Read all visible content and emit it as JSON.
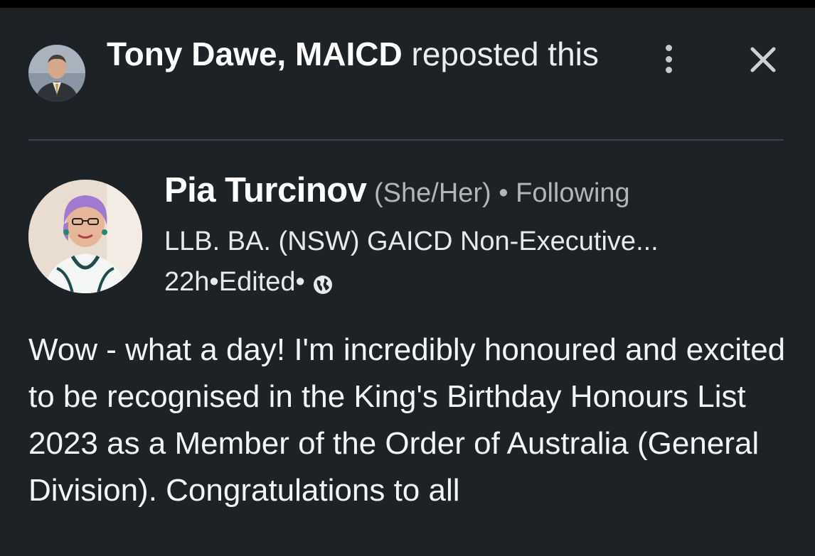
{
  "repost": {
    "name": "Tony Dawe, MAICD",
    "action": " reposted this"
  },
  "author": {
    "name": "Pia Turcinov",
    "pronouns": " (She/Her)",
    "separator1": " • ",
    "follow_status": "Following",
    "headline": "LLB. BA. (NSW) GAICD Non-Executive...",
    "time": "22h",
    "separator2": " • ",
    "edited": "Edited",
    "separator3": " • "
  },
  "post": {
    "text": "Wow - what a day! I'm incredibly honoured and excited to be recognised in the King's Birthday Honours List 2023 as a Member of the Order of Australia (General Division). Congratulations to all"
  },
  "icons": {
    "more": "more-vertical-icon",
    "close": "close-icon",
    "visibility": "globe-icon"
  },
  "colors": {
    "background": "#1d2226",
    "text_primary": "#ffffff",
    "text_secondary": "#b0b6ba",
    "divider": "#3c4247"
  }
}
